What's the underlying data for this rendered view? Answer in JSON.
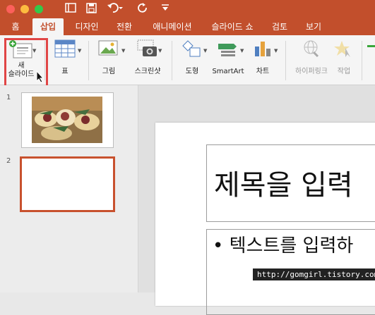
{
  "toolbar": {
    "icons": [
      "sidebar-toggle-icon",
      "save-icon",
      "undo-icon",
      "redo-icon",
      "customize-icon"
    ]
  },
  "tabs": [
    {
      "label": "홈"
    },
    {
      "label": "삽입"
    },
    {
      "label": "디자인"
    },
    {
      "label": "전환"
    },
    {
      "label": "애니메이션"
    },
    {
      "label": "슬라이드 쇼"
    },
    {
      "label": "검토"
    },
    {
      "label": "보기"
    }
  ],
  "active_tab": "삽입",
  "ribbon": {
    "new_slide_line1": "새",
    "new_slide_line2": "슬라이드",
    "table": "표",
    "picture": "그림",
    "screenshot": "스크린샷",
    "shapes": "도형",
    "smartart": "SmartArt",
    "chart": "차트",
    "hyperlink": "하이퍼링크",
    "action": "작업"
  },
  "slides": [
    {
      "number": "1"
    },
    {
      "number": "2"
    }
  ],
  "slide": {
    "title_placeholder": "제목을 입력",
    "body_placeholder": "• 텍스트를 입력하"
  },
  "watermark": "http://gomgirl.tistory.com",
  "colors": {
    "accent": "#c24f2c",
    "highlight": "#e04646",
    "selected_slide": "#c8512e"
  }
}
